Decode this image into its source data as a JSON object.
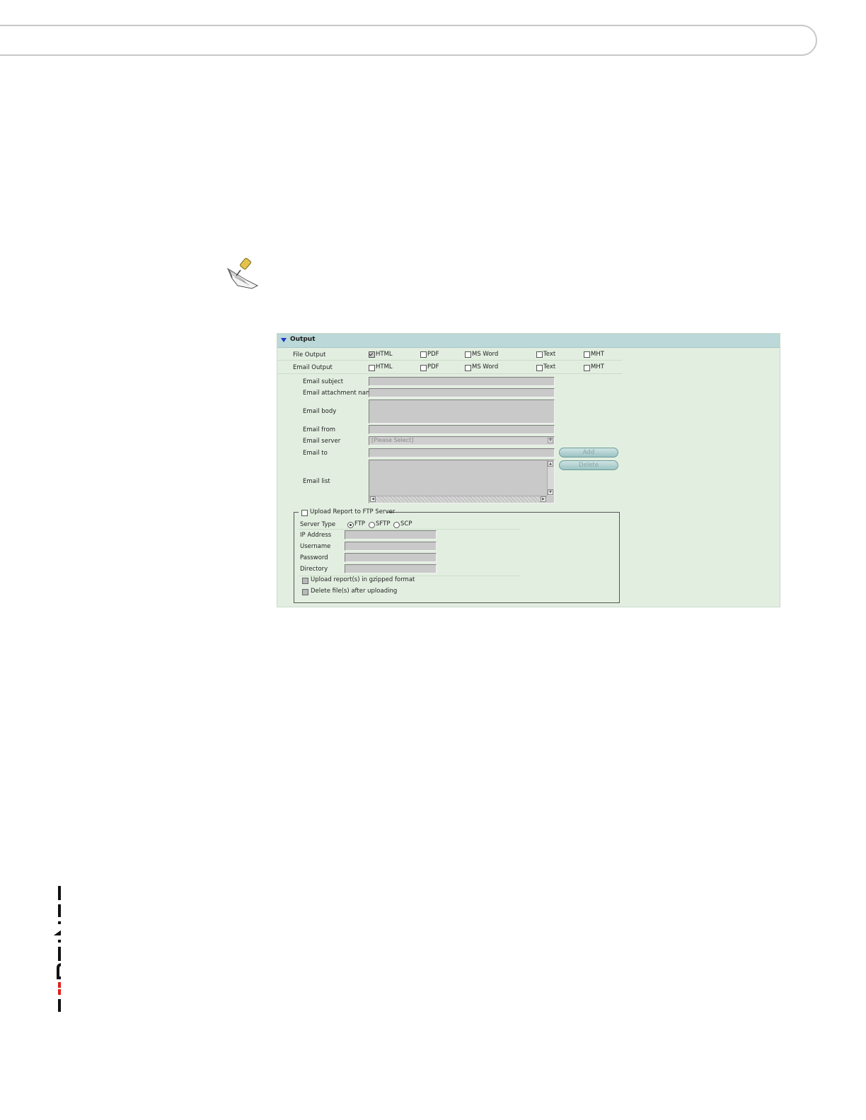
{
  "output_panel": {
    "title": "Output",
    "file_output": {
      "label": "File Output",
      "options": [
        {
          "label": "HTML",
          "checked": true
        },
        {
          "label": "PDF",
          "checked": false
        },
        {
          "label": "MS Word",
          "checked": false
        },
        {
          "label": "Text",
          "checked": false
        },
        {
          "label": "MHT",
          "checked": false
        }
      ]
    },
    "email_output": {
      "label": "Email Output",
      "options": [
        {
          "label": "HTML",
          "checked": false
        },
        {
          "label": "PDF",
          "checked": false
        },
        {
          "label": "MS Word",
          "checked": false
        },
        {
          "label": "Text",
          "checked": false
        },
        {
          "label": "MHT",
          "checked": false
        }
      ]
    },
    "email": {
      "subject_label": "Email subject",
      "attachment_label": "Email attachment name",
      "body_label": "Email body",
      "from_label": "Email from",
      "server_label": "Email server",
      "server_value": "[Please Select]",
      "to_label": "Email to",
      "list_label": "Email list",
      "add_label": "Add",
      "delete_label": "Delete"
    },
    "ftp": {
      "upload_label": "Upload Report to FTP Server",
      "server_type_label": "Server Type",
      "server_types": [
        "FTP",
        "SFTP",
        "SCP"
      ],
      "ip_label": "IP Address",
      "username_label": "Username",
      "password_label": "Password",
      "directory_label": "Directory",
      "gzip_label": "Upload report(s) in gzipped format",
      "delete_after_label": "Delete file(s) after uploading"
    }
  },
  "icons": {
    "note": "note-pushpin-icon",
    "logo": "fortinet-logo"
  }
}
